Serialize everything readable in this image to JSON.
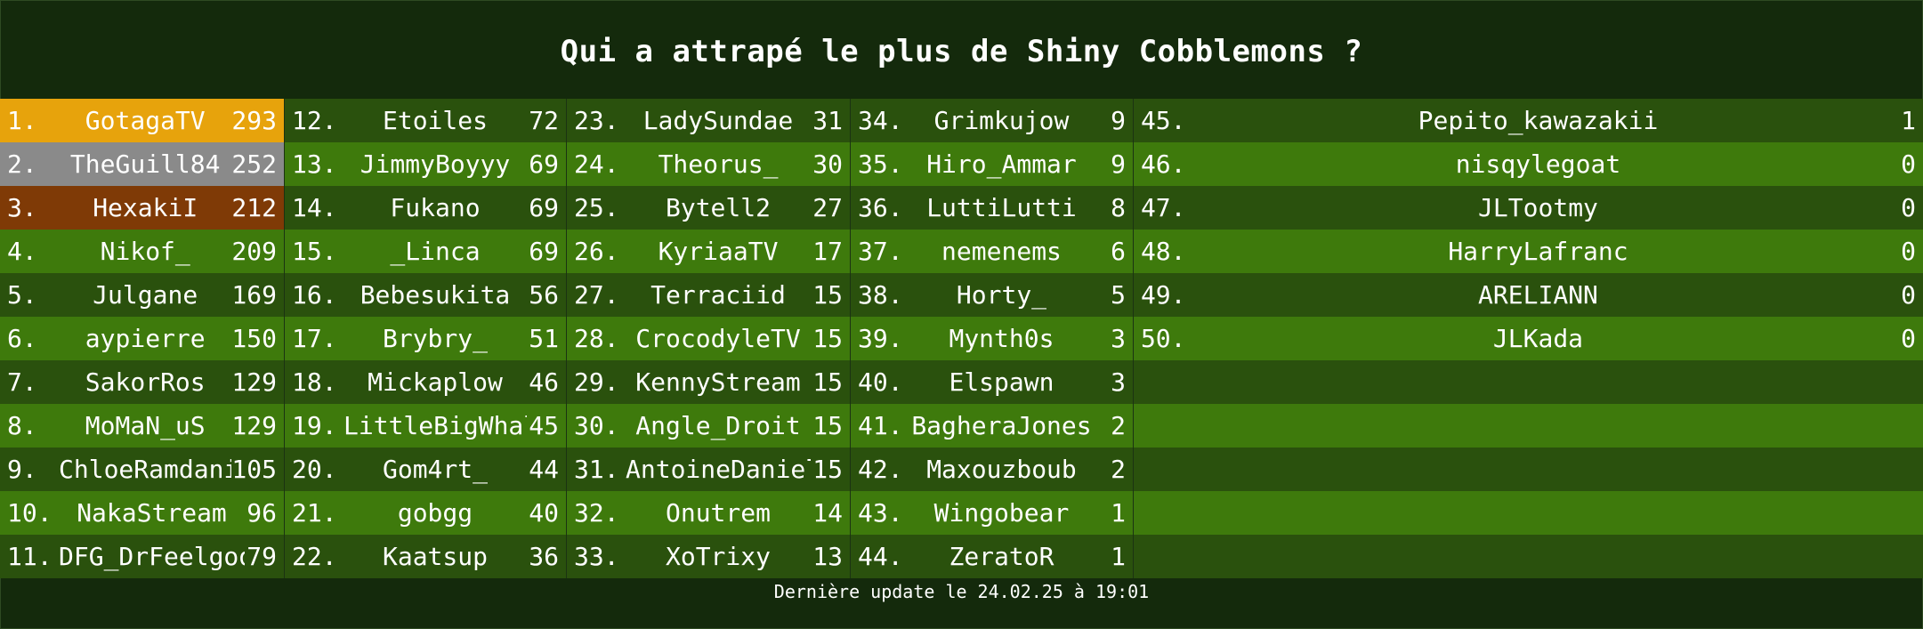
{
  "title": "Qui a attrapé le plus de Shiny Cobblemons ?",
  "footer": "Dernière update le 24.02.25 à 19:01",
  "colors": {
    "background": "#142a0c",
    "row_dark": "#2a510d",
    "row_light": "#3e7a0c",
    "gold": "#e7a30c",
    "silver": "#8a8a8a",
    "bronze": "#7f3a06"
  },
  "entries": [
    {
      "rank": "1.",
      "name": "GotagaTV",
      "score": "293"
    },
    {
      "rank": "2.",
      "name": "TheGuill84",
      "score": "252"
    },
    {
      "rank": "3.",
      "name": "HexakiI",
      "score": "212"
    },
    {
      "rank": "4.",
      "name": "Nikof_",
      "score": "209"
    },
    {
      "rank": "5.",
      "name": "Julgane",
      "score": "169"
    },
    {
      "rank": "6.",
      "name": "aypierre",
      "score": "150"
    },
    {
      "rank": "7.",
      "name": "SakorRos",
      "score": "129"
    },
    {
      "rank": "8.",
      "name": "MoMaN_uS",
      "score": "129"
    },
    {
      "rank": "9.",
      "name": "ChloeRamdani",
      "score": "105"
    },
    {
      "rank": "10.",
      "name": "NakaStream",
      "score": "96"
    },
    {
      "rank": "11.",
      "name": "DFG_DrFeelgood",
      "score": "79"
    },
    {
      "rank": "12.",
      "name": "Etoiles",
      "score": "72"
    },
    {
      "rank": "13.",
      "name": "JimmyBoyyy",
      "score": "69"
    },
    {
      "rank": "14.",
      "name": "Fukano",
      "score": "69"
    },
    {
      "rank": "15.",
      "name": "_Linca",
      "score": "69"
    },
    {
      "rank": "16.",
      "name": "Bebesukita",
      "score": "56"
    },
    {
      "rank": "17.",
      "name": "Brybry_",
      "score": "51"
    },
    {
      "rank": "18.",
      "name": "Mickaplow",
      "score": "46"
    },
    {
      "rank": "19.",
      "name": "LittleBigWhale",
      "score": "45"
    },
    {
      "rank": "20.",
      "name": "Gom4rt_",
      "score": "44"
    },
    {
      "rank": "21.",
      "name": "gobgg",
      "score": "40"
    },
    {
      "rank": "22.",
      "name": "Kaatsup",
      "score": "36"
    },
    {
      "rank": "23.",
      "name": "LadySundae",
      "score": "31"
    },
    {
      "rank": "24.",
      "name": "Theorus_",
      "score": "30"
    },
    {
      "rank": "25.",
      "name": "Bytell2",
      "score": "27"
    },
    {
      "rank": "26.",
      "name": "KyriaaTV",
      "score": "17"
    },
    {
      "rank": "27.",
      "name": "Terraciid",
      "score": "15"
    },
    {
      "rank": "28.",
      "name": "CrocodyleTV",
      "score": "15"
    },
    {
      "rank": "29.",
      "name": "KennyStream",
      "score": "15"
    },
    {
      "rank": "30.",
      "name": "Angle_Droit",
      "score": "15"
    },
    {
      "rank": "31.",
      "name": "AntoineDaniel_",
      "score": "15"
    },
    {
      "rank": "32.",
      "name": "Onutrem",
      "score": "14"
    },
    {
      "rank": "33.",
      "name": "XoTrixy",
      "score": "13"
    },
    {
      "rank": "34.",
      "name": "Grimkujow",
      "score": "9"
    },
    {
      "rank": "35.",
      "name": "Hiro_Ammar",
      "score": "9"
    },
    {
      "rank": "36.",
      "name": "LuttiLutti",
      "score": "8"
    },
    {
      "rank": "37.",
      "name": "nemenems",
      "score": "6"
    },
    {
      "rank": "38.",
      "name": "Horty_",
      "score": "5"
    },
    {
      "rank": "39.",
      "name": "Mynth0s",
      "score": "3"
    },
    {
      "rank": "40.",
      "name": "Elspawn",
      "score": "3"
    },
    {
      "rank": "41.",
      "name": "BagheraJones",
      "score": "2"
    },
    {
      "rank": "42.",
      "name": "Maxouzboub",
      "score": "2"
    },
    {
      "rank": "43.",
      "name": "Wingobear",
      "score": "1"
    },
    {
      "rank": "44.",
      "name": "ZeratoR",
      "score": "1"
    },
    {
      "rank": "45.",
      "name": "Pepito_kawazakii",
      "score": "1"
    },
    {
      "rank": "46.",
      "name": "nisqylegoat",
      "score": "0"
    },
    {
      "rank": "47.",
      "name": "JLTootmy",
      "score": "0"
    },
    {
      "rank": "48.",
      "name": "HarryLafranc",
      "score": "0"
    },
    {
      "rank": "49.",
      "name": "ARELIANN",
      "score": "0"
    },
    {
      "rank": "50.",
      "name": "JLKada",
      "score": "0"
    }
  ]
}
